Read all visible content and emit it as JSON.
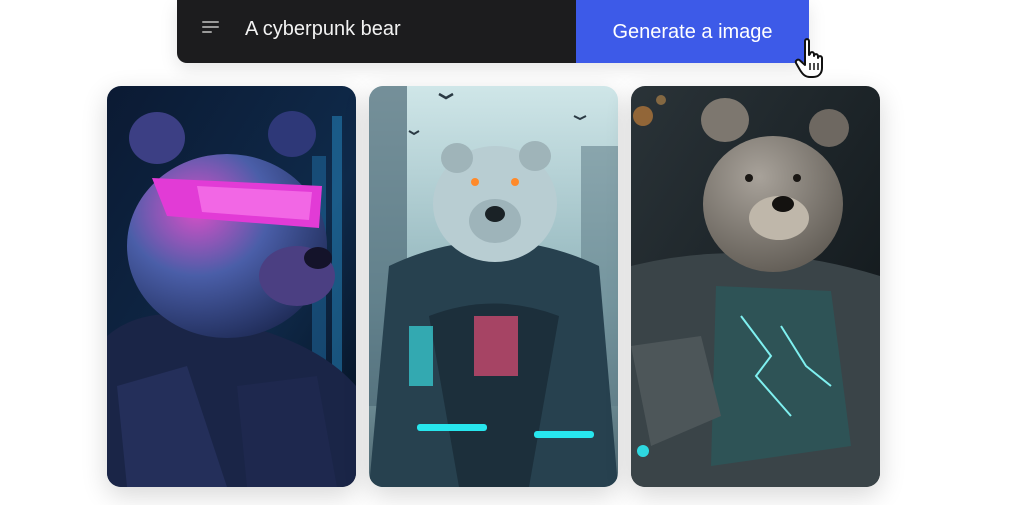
{
  "prompt": {
    "icon": "menu-lines-icon",
    "value": "A cyberpunk bear"
  },
  "generate_button": {
    "label": "Generate a image",
    "color": "#3d5ae8"
  },
  "cursor": {
    "icon": "hand-pointer-icon"
  },
  "results": [
    {
      "name": "neon-visor-cyberpunk-bear",
      "accent": "#e23bd6"
    },
    {
      "name": "polar-bear-cyber-jacket",
      "accent": "#27e6ee"
    },
    {
      "name": "armored-bear-electric-suit",
      "accent": "#7ff0f0"
    }
  ]
}
